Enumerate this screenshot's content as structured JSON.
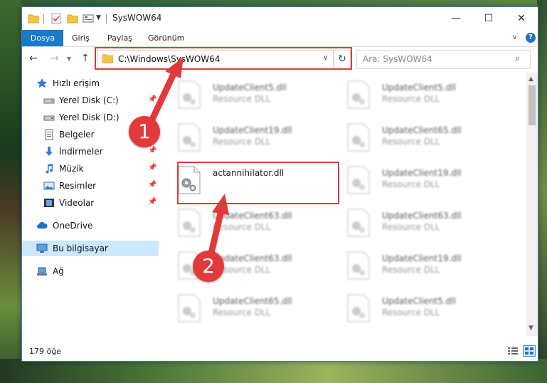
{
  "window": {
    "title": "SysWOW64",
    "controls": {
      "minimize": "—",
      "maximize": "☐",
      "close": "✕"
    }
  },
  "ribbon": {
    "tabs": [
      "Dosya",
      "Giriş",
      "Paylaş",
      "Görünüm"
    ],
    "help": "?"
  },
  "address_bar": {
    "path": "C:\\Windows\\SysWOW64",
    "refresh_icon": "↻"
  },
  "search": {
    "placeholder": "Ara: SysWOW64"
  },
  "sidebar": {
    "items": [
      {
        "label": "Hızlı erişim",
        "icon": "star-icon"
      },
      {
        "label": "Yerel Disk (C:)",
        "icon": "drive-icon",
        "pinned": true
      },
      {
        "label": "Yerel Disk (D:)",
        "icon": "drive-icon",
        "pinned": false
      },
      {
        "label": "Belgeler",
        "icon": "documents-icon",
        "pinned": false
      },
      {
        "label": "İndirmeler",
        "icon": "download-icon",
        "pinned": true
      },
      {
        "label": "Müzik",
        "icon": "music-icon",
        "pinned": true
      },
      {
        "label": "Resimler",
        "icon": "pictures-icon",
        "pinned": true
      },
      {
        "label": "Videolar",
        "icon": "video-icon",
        "pinned": true
      },
      {
        "label": "OneDrive",
        "icon": "cloud-icon"
      },
      {
        "label": "Bu bilgisayar",
        "icon": "computer-icon",
        "selected": true
      },
      {
        "label": "Ağ",
        "icon": "network-icon"
      }
    ]
  },
  "files": [
    {
      "name": "UpdateClient5.dll",
      "type": "Resource DLL",
      "blurred": true
    },
    {
      "name": "UpdateClient5.dll",
      "type": "Resource DLL",
      "blurred": true
    },
    {
      "name": "UpdateClient19.dll",
      "type": "Resource DLL",
      "blurred": true
    },
    {
      "name": "UpdateClient65.dll",
      "type": "Resource DLL",
      "blurred": true
    },
    {
      "name": "actannihilator.dll",
      "type": "",
      "blurred": false,
      "highlighted": true
    },
    {
      "name": "UpdateClient19.dll",
      "type": "Resource DLL",
      "blurred": true
    },
    {
      "name": "UpdateClient63.dll",
      "type": "Resource DLL",
      "blurred": true
    },
    {
      "name": "UpdateClient63.dll",
      "type": "Resource DLL",
      "blurred": true
    },
    {
      "name": "UpdateClient63.dll",
      "type": "Resource DLL",
      "blurred": true
    },
    {
      "name": "UpdateClient19.dll",
      "type": "Resource DLL",
      "blurred": true
    },
    {
      "name": "UpdateClient65.dll",
      "type": "Resource DLL",
      "blurred": true
    },
    {
      "name": "UpdateClient5.dll",
      "type": "Resource DLL",
      "blurred": true
    }
  ],
  "status": {
    "count": "179 öğe"
  },
  "callouts": [
    "1",
    "2"
  ],
  "colors": {
    "accent": "#1979ca",
    "highlight": "#e03a3a",
    "selected": "#cce8ff"
  }
}
